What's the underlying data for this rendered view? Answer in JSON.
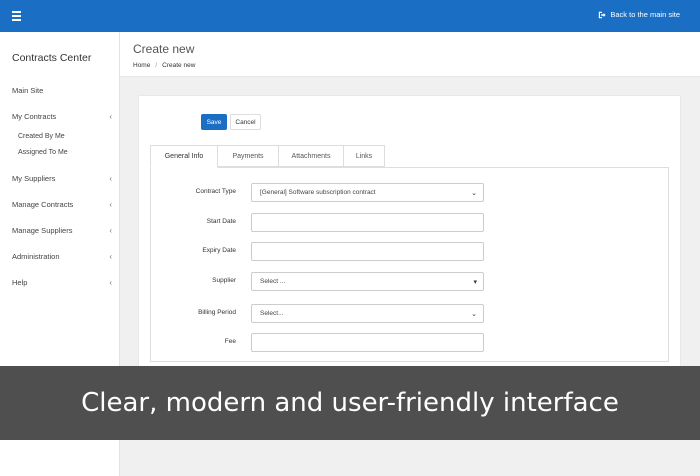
{
  "topbar": {
    "menu_icon": "hamburger-icon",
    "back_label": "Back to the main site",
    "back_icon": "sign-out-icon",
    "color": "#1a6fc4"
  },
  "sidebar": {
    "brand": "Contracts Center",
    "items": [
      {
        "label": "Main Site",
        "chevron": false
      },
      {
        "label": "My Contracts",
        "chevron": true
      },
      {
        "label": "Created By Me",
        "chevron": false
      },
      {
        "label": "Assigned To Me",
        "chevron": false
      },
      {
        "label": "My Suppliers",
        "chevron": true
      },
      {
        "label": "Manage Contracts",
        "chevron": true
      },
      {
        "label": "Manage Suppliers",
        "chevron": true
      },
      {
        "label": "Administration",
        "chevron": true
      },
      {
        "label": "Help",
        "chevron": true
      }
    ]
  },
  "header": {
    "title": "Create new",
    "breadcrumb": {
      "home": "Home",
      "separator": "/",
      "current": "Create new"
    }
  },
  "actions": {
    "save": "Save",
    "cancel": "Cancel"
  },
  "tabs": [
    {
      "label": "General Info",
      "active": true
    },
    {
      "label": "Payments",
      "active": false
    },
    {
      "label": "Attachments",
      "active": false
    },
    {
      "label": "Links",
      "active": false
    }
  ],
  "form": {
    "contract_type": {
      "label": "Contract Type",
      "value": "[General] Software subscription contract"
    },
    "start_date": {
      "label": "Start Date",
      "value": ""
    },
    "expiry_date": {
      "label": "Expiry Date",
      "value": ""
    },
    "supplier": {
      "label": "Supplier",
      "value": "Select ..."
    },
    "billing_period": {
      "label": "Billing Period",
      "value": "Select..."
    },
    "fee": {
      "label": "Fee",
      "value": ""
    }
  },
  "banner": {
    "text": "Clear, modern and user-friendly interface"
  }
}
